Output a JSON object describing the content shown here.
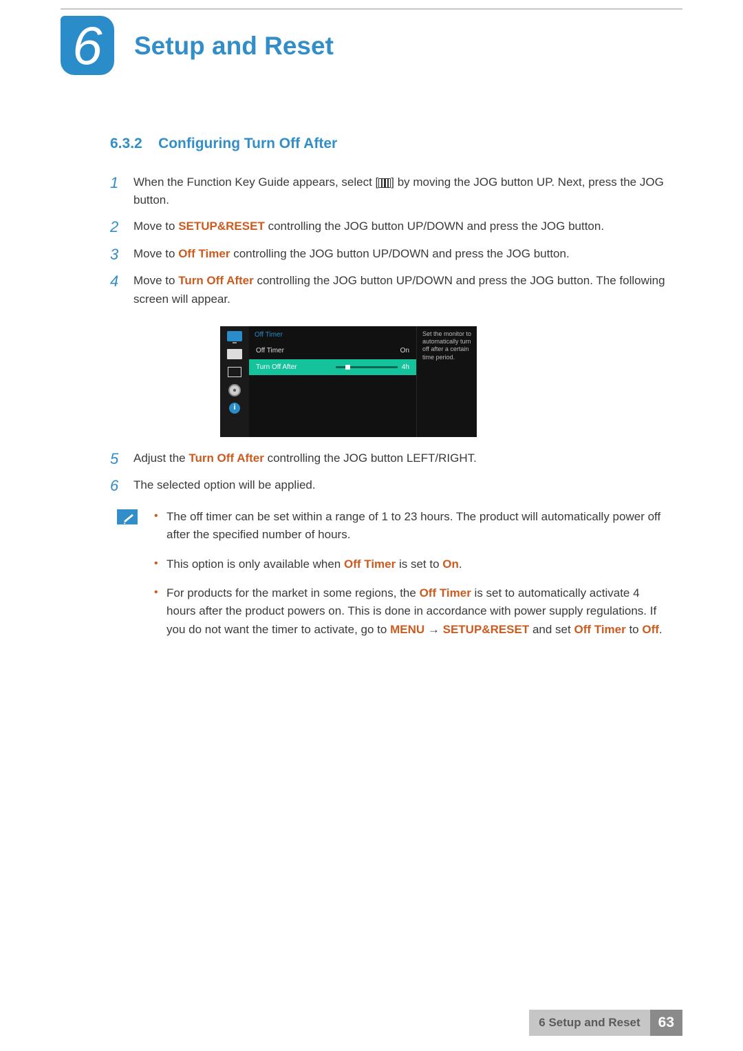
{
  "chapter": {
    "number": "6",
    "title": "Setup and Reset"
  },
  "section": {
    "number": "6.3.2",
    "title": "Configuring Turn Off After"
  },
  "steps": [
    {
      "num": "1",
      "pre": "When the Function Key Guide appears, select [",
      "post": "] by moving the JOG button UP. Next, press the JOG button."
    },
    {
      "num": "2",
      "pre": "Move to ",
      "bold": "SETUP&RESET",
      "post": " controlling the JOG button UP/DOWN and press the JOG button."
    },
    {
      "num": "3",
      "pre": "Move to ",
      "bold": "Off Timer",
      "post": " controlling the JOG button UP/DOWN and press the JOG button."
    },
    {
      "num": "4",
      "pre": "Move to ",
      "bold": "Turn Off After",
      "post": " controlling the JOG button UP/DOWN and press the JOG button. The following screen will appear."
    },
    {
      "num": "5",
      "pre": "Adjust the ",
      "bold": "Turn Off After",
      "post": " controlling the JOG button LEFT/RIGHT."
    },
    {
      "num": "6",
      "text": "The selected option will be applied."
    }
  ],
  "osd": {
    "header": "Off Timer",
    "row1": {
      "label": "Off Timer",
      "value": "On"
    },
    "row2": {
      "label": "Turn Off After",
      "value": "4h"
    },
    "hint": "Set the monitor to automatically turn off after a certain time period.",
    "info_glyph": "i"
  },
  "notes": [
    {
      "text": "The off timer can be set within a range of 1 to 23 hours. The product will automatically power off after the specified number of hours."
    },
    {
      "parts": [
        {
          "t": "This option is only available when "
        },
        {
          "t": "Off Timer",
          "b": true
        },
        {
          "t": " is set to "
        },
        {
          "t": "On",
          "b": true
        },
        {
          "t": "."
        }
      ]
    },
    {
      "parts": [
        {
          "t": "For products for the market in some regions, the "
        },
        {
          "t": "Off Timer",
          "b": true
        },
        {
          "t": " is set to automatically activate 4 hours after the product powers on. This is done in accordance with power supply regulations. If you do not want the timer to activate, go to "
        },
        {
          "t": "MENU",
          "b": true
        },
        {
          "t": "  "
        },
        {
          "arrow": "→"
        },
        {
          "t": "  "
        },
        {
          "t": "SETUP&RESET",
          "b": true
        },
        {
          "t": " and set "
        },
        {
          "t": "Off Timer",
          "b": true
        },
        {
          "t": " to "
        },
        {
          "t": "Off",
          "b": true
        },
        {
          "t": "."
        }
      ]
    }
  ],
  "footer": {
    "label": "6 Setup and Reset",
    "page": "63"
  }
}
